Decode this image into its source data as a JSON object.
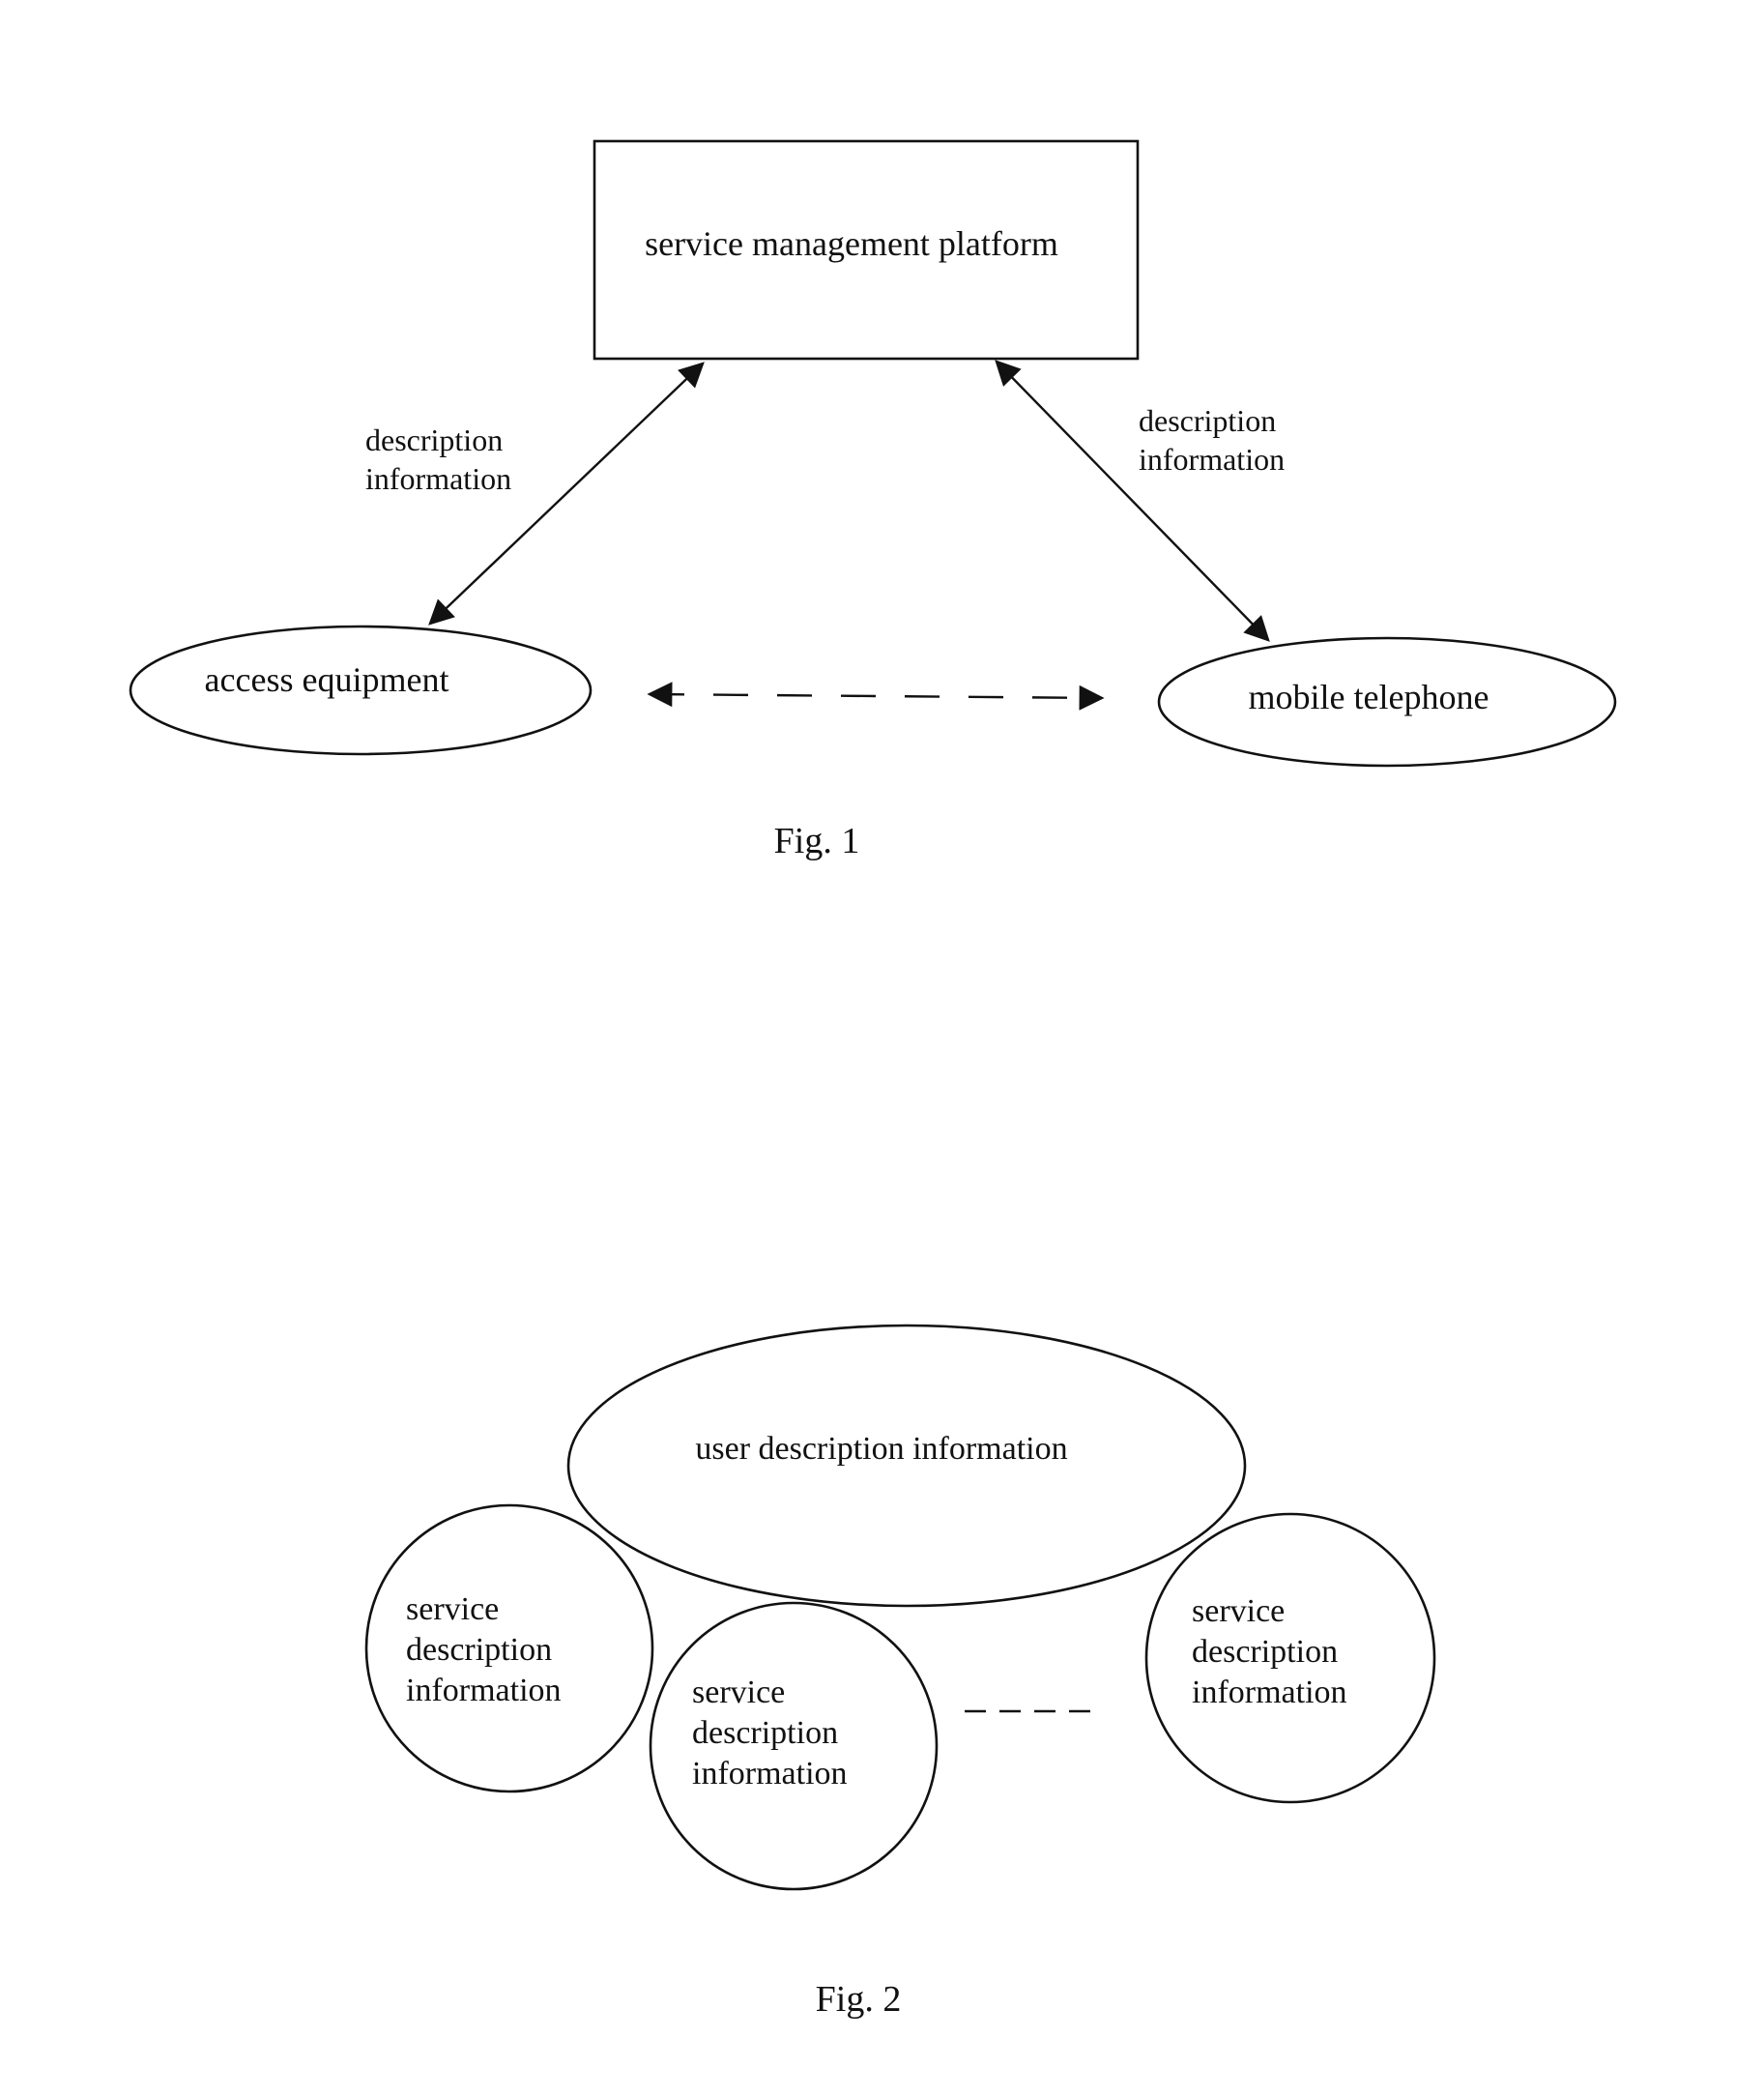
{
  "figure1": {
    "caption": "Fig. 1",
    "nodes": {
      "platform": "service management platform",
      "access": "access equipment",
      "mobile": "mobile telephone"
    },
    "edge_labels": {
      "left": [
        "description",
        "information"
      ],
      "right": [
        "description",
        "information"
      ]
    }
  },
  "figure2": {
    "caption": "Fig. 2",
    "user": "user description information",
    "services": [
      [
        "service",
        "description",
        "information"
      ],
      [
        "service",
        "description",
        "information"
      ],
      [
        "service",
        "description",
        "information"
      ]
    ]
  }
}
